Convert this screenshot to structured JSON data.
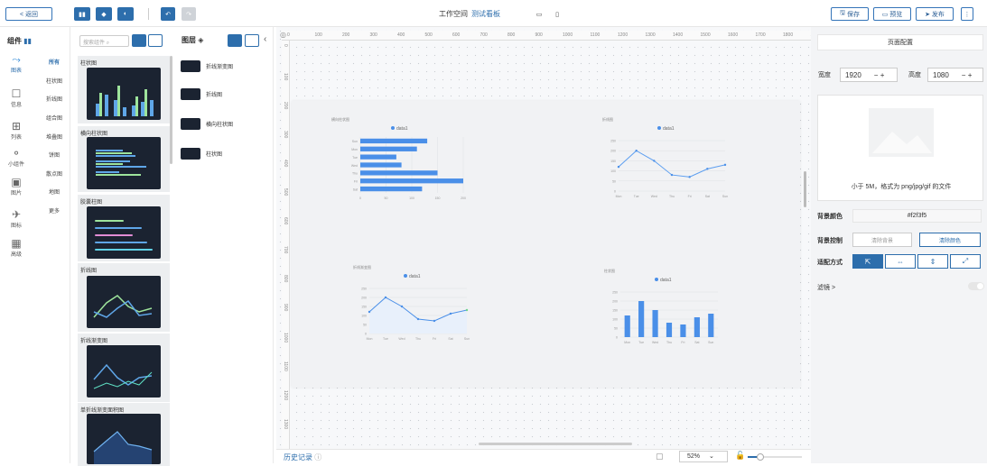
{
  "toolbar": {
    "back_label": "< 返回",
    "workspace_label": "工作空间",
    "board_name": "测试看板",
    "save_label": "保存",
    "preview_label": "预览",
    "publish_label": "发布"
  },
  "components": {
    "title": "组件",
    "search_placeholder": "搜索组件",
    "categories": [
      {
        "label": "图表"
      },
      {
        "label": "信息"
      },
      {
        "label": "列表"
      },
      {
        "label": "小组件"
      },
      {
        "label": "图片"
      },
      {
        "label": "图标"
      },
      {
        "label": "高级"
      }
    ],
    "subcategories": [
      {
        "label": "所有"
      },
      {
        "label": "柱状图"
      },
      {
        "label": "折线图"
      },
      {
        "label": "组合图"
      },
      {
        "label": "堆叠图"
      },
      {
        "label": "饼图"
      },
      {
        "label": "散点图"
      },
      {
        "label": "地图"
      },
      {
        "label": "更多"
      }
    ],
    "cards": [
      {
        "title": "柱状图"
      },
      {
        "title": "横向柱状图"
      },
      {
        "title": "胶囊柱图"
      },
      {
        "title": "折线图"
      },
      {
        "title": "折线渐变图"
      },
      {
        "title": "单折线渐变面积图"
      }
    ]
  },
  "layers": {
    "title": "图层",
    "items": [
      {
        "label": "折线渐变图"
      },
      {
        "label": "折线图"
      },
      {
        "label": "横向柱状图"
      },
      {
        "label": "柱状图"
      }
    ]
  },
  "canvas": {
    "ruler_h": [
      "0",
      "100",
      "200",
      "300",
      "400",
      "500",
      "600",
      "700",
      "800",
      "900",
      "1000",
      "1100",
      "1200",
      "1300",
      "1400",
      "1500",
      "1600",
      "1700",
      "1800",
      "1900"
    ],
    "ruler_v": [
      "0",
      "100",
      "200",
      "300",
      "400",
      "500",
      "600",
      "700",
      "800",
      "900",
      "1000",
      "1100",
      "1200",
      "1300"
    ],
    "history_label": "历史记录",
    "zoom": "52%",
    "charts": [
      {
        "title": "横向柱状图",
        "legend": "data1"
      },
      {
        "title": "折线图",
        "legend": "data1"
      },
      {
        "title": "折线渐变图",
        "legend": "data1"
      },
      {
        "title": "柱状图",
        "legend": "data1"
      }
    ]
  },
  "right": {
    "tab": "页面配置",
    "width_label": "宽度",
    "width": "1920",
    "height_label": "高度",
    "height": "1080",
    "upload_hint": "小于 5M，格式为 png/jpg/gif 的文件",
    "bg_color_label": "背景颜色",
    "bg_color": "#f2f3f5",
    "bg_control_label": "背景控制",
    "clear_bg": "清除背景",
    "clear_color": "清除颜色",
    "fit_label": "适配方式",
    "filter_label": "滤镜 >"
  },
  "chart_data": [
    {
      "type": "bar",
      "orientation": "horizontal",
      "categories": [
        "Sat",
        "Fri",
        "Thu",
        "Wed",
        "Tue",
        "Mon",
        "Sun"
      ],
      "values": [
        120,
        200,
        150,
        80,
        70,
        110,
        130
      ],
      "legend": "data1"
    },
    {
      "type": "line",
      "categories": [
        "Mon",
        "Tue",
        "Wed",
        "Thu",
        "Fri",
        "Sat",
        "Sun"
      ],
      "values": [
        120,
        200,
        150,
        80,
        70,
        110,
        130
      ],
      "legend": "data1"
    },
    {
      "type": "area",
      "categories": [
        "Mon",
        "Tue",
        "Wed",
        "Thu",
        "Fri",
        "Sat",
        "Sun"
      ],
      "values": [
        120,
        200,
        150,
        80,
        70,
        110,
        130
      ],
      "legend": "data1"
    },
    {
      "type": "bar",
      "categories": [
        "Mon",
        "Tue",
        "Wed",
        "Thu",
        "Fri",
        "Sat",
        "Sun"
      ],
      "values": [
        120,
        200,
        150,
        80,
        70,
        110,
        130
      ],
      "legend": "data1"
    }
  ]
}
